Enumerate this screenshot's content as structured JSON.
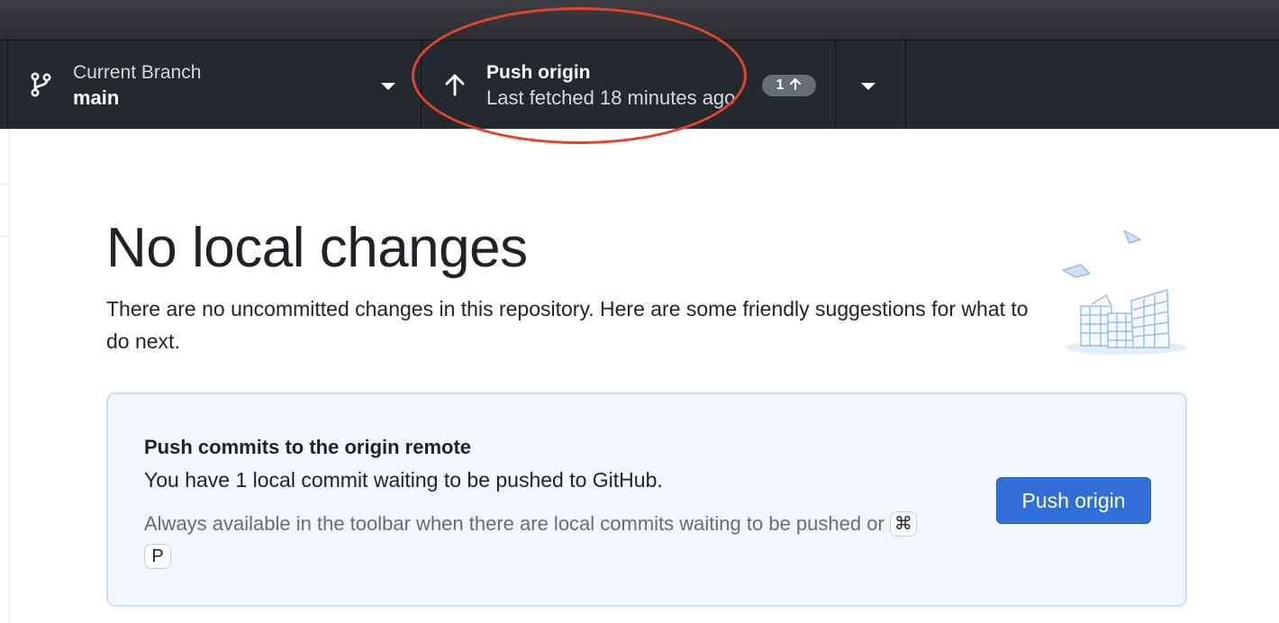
{
  "toolbar": {
    "branch": {
      "label": "Current Branch",
      "name": "main",
      "icon": "git-branch-icon"
    },
    "push": {
      "label": "Push origin",
      "subtitle": "Last fetched 18 minutes ago",
      "badge_count": "1",
      "icon": "arrow-up-icon"
    }
  },
  "main": {
    "title": "No local changes",
    "description": "There are no uncommitted changes in this repository. Here are some friendly suggestions for what to do next.",
    "card": {
      "title": "Push commits to the origin remote",
      "text": "You have 1 local commit waiting to be pushed to GitHub.",
      "hint": "Always available in the toolbar when there are local commits waiting to be pushed or",
      "shortcut_keys": [
        "⌘",
        "P"
      ],
      "button_label": "Push origin"
    }
  },
  "colors": {
    "toolbar_bg": "#24292f",
    "accent": "#2f6fd6",
    "annotation": "#e0452b"
  }
}
